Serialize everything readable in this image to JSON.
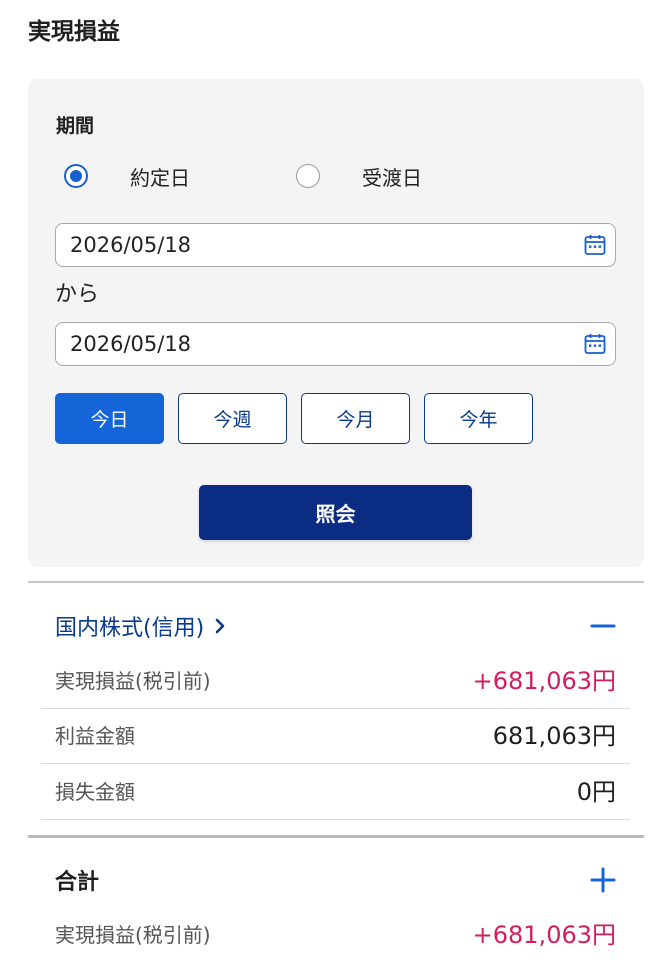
{
  "page": {
    "title": "実現損益"
  },
  "filter": {
    "period_label": "期間",
    "radio_options": [
      {
        "label": "約定日",
        "checked": true
      },
      {
        "label": "受渡日",
        "checked": false
      }
    ],
    "start_date": "2026/05/18",
    "from_label": "から",
    "end_date": "2026/05/18",
    "quick_ranges": [
      {
        "label": "今日",
        "active": true
      },
      {
        "label": "今週",
        "active": false
      },
      {
        "label": "今月",
        "active": false
      },
      {
        "label": "今年",
        "active": false
      }
    ],
    "submit_label": "照会"
  },
  "sections": [
    {
      "title": "国内株式(信用)",
      "toggle": "minus",
      "rows": [
        {
          "label": "実現損益(税引前)",
          "value": "+681,063円"
        },
        {
          "label": "利益金額",
          "value": "681,063円"
        },
        {
          "label": "損失金額",
          "value": "0円"
        }
      ]
    },
    {
      "title": "合計",
      "toggle": "plus",
      "rows": [
        {
          "label": "実現損益(税引前)",
          "value": "+681,063円"
        }
      ]
    }
  ],
  "colors": {
    "accent_blue": "#1565d8",
    "navy": "#0a2d83",
    "link_blue": "#0a3a8a",
    "positive_red": "#d41e5c",
    "card_bg": "#f4f4f5"
  },
  "icons": {
    "calendar": "calendar-icon",
    "chevron": "chevron-right-icon",
    "minus": "minus-icon",
    "plus": "plus-icon"
  }
}
